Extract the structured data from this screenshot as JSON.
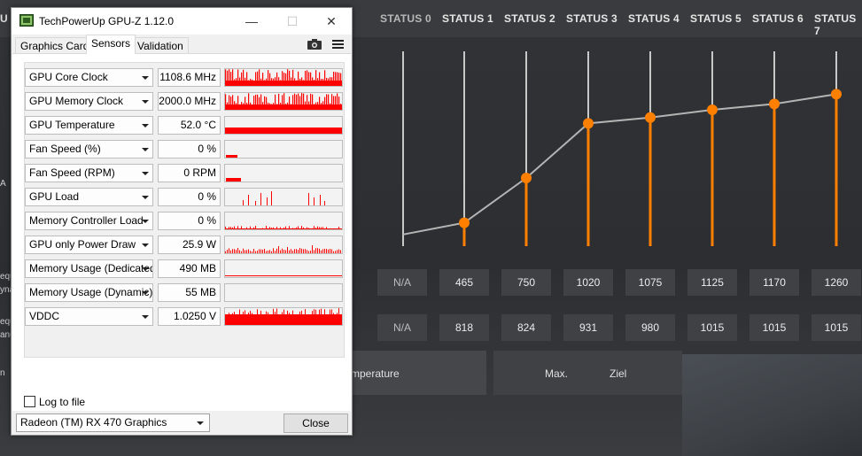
{
  "background_app": {
    "edge_text_top": "U",
    "status_tabs": [
      "STATUS 0",
      "STATUS 1",
      "STATUS 2",
      "STATUS 3",
      "STATUS 4",
      "STATUS 5",
      "STATUS 6",
      "STATUS 7"
    ],
    "row1": [
      "N/A",
      "465",
      "750",
      "1020",
      "1075",
      "1125",
      "1170",
      "1260"
    ],
    "row2": [
      "N/A",
      "818",
      "824",
      "931",
      "980",
      "1015",
      "1015",
      "1015"
    ],
    "temperature_label": "mperature",
    "max_label": "Max.",
    "target_label": "Ziel",
    "left_fragments": [
      "A",
      "equ",
      "yna",
      "equ",
      "anu",
      "n"
    ],
    "curve_levels": [
      0.06,
      0.12,
      0.35,
      0.63,
      0.66,
      0.7,
      0.73,
      0.78
    ],
    "colors": {
      "accent": "#ff8000",
      "line": "#b4b4b4"
    }
  },
  "window": {
    "title": "TechPowerUp GPU-Z 1.12.0",
    "icons": {
      "app": "gpuz-app-icon",
      "minimize": "minimize-icon",
      "maximize": "maximize-icon",
      "close": "close-icon",
      "camera": "camera-icon",
      "menu": "hamburger-menu-icon"
    },
    "tabs": [
      {
        "label": "Graphics Card",
        "active": false
      },
      {
        "label": "Sensors",
        "active": true
      },
      {
        "label": "Validation",
        "active": false
      }
    ],
    "sensors": [
      {
        "label": "GPU Core Clock",
        "value": "1108.6 MHz",
        "graph": "spiky-high"
      },
      {
        "label": "GPU Memory Clock",
        "value": "2000.0 MHz",
        "graph": "spiky-high"
      },
      {
        "label": "GPU Temperature",
        "value": "52.0 °C",
        "graph": "flat-mid"
      },
      {
        "label": "Fan Speed (%)",
        "value": "0 %",
        "graph": "stub-low"
      },
      {
        "label": "Fan Speed (RPM)",
        "value": "0 RPM",
        "graph": "stub-mid"
      },
      {
        "label": "GPU Load",
        "value": "0 %",
        "graph": "sparse-spikes"
      },
      {
        "label": "Memory Controller Load",
        "value": "0 %",
        "graph": "low-noise"
      },
      {
        "label": "GPU only Power Draw",
        "value": "25.9 W",
        "graph": "low-noise-spikes"
      },
      {
        "label": "Memory Usage (Dedicated)",
        "value": "490 MB",
        "graph": "thin-line"
      },
      {
        "label": "Memory Usage (Dynamic)",
        "value": "55 MB",
        "graph": "empty"
      },
      {
        "label": "VDDC",
        "value": "1.0250 V",
        "graph": "dense-high"
      }
    ],
    "log_to_file": {
      "label": "Log to file",
      "checked": false
    },
    "gpu_select": "Radeon (TM) RX 470 Graphics",
    "close_button": "Close",
    "colors": {
      "graph": "#ff0000"
    }
  }
}
